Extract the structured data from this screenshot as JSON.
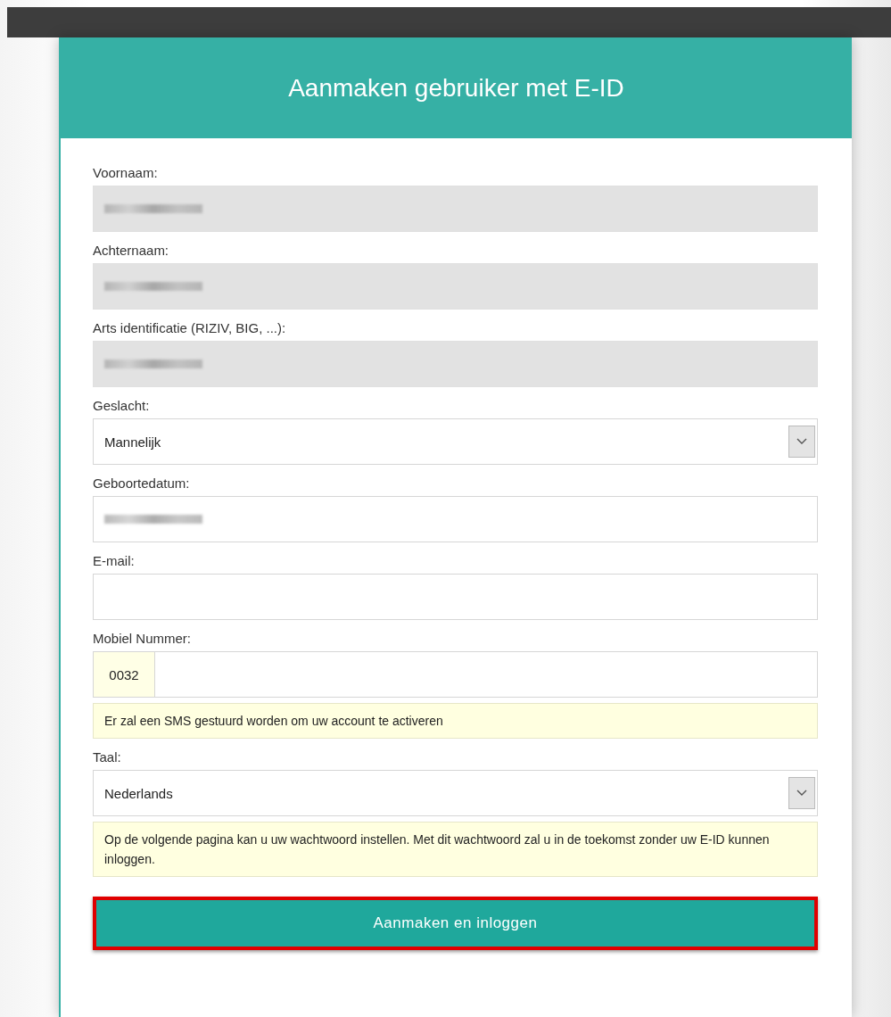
{
  "header": {
    "title": "Aanmaken gebruiker met E-ID"
  },
  "fields": [
    {
      "kind": "readonly",
      "label": "Voornaam:",
      "redacted": true
    },
    {
      "kind": "readonly",
      "label": "Achternaam:",
      "redacted": true
    },
    {
      "kind": "readonly",
      "label": "Arts identificatie (RIZIV, BIG, ...):",
      "redacted": true
    },
    {
      "kind": "select",
      "label": "Geslacht:",
      "value": "Mannelijk"
    },
    {
      "kind": "text",
      "label": "Geboortedatum:",
      "redacted": true
    },
    {
      "kind": "text",
      "label": "E-mail:",
      "redacted": false
    },
    {
      "kind": "phone",
      "label": "Mobiel Nummer:",
      "prefix": "0032",
      "notice": "Er zal een SMS gestuurd worden om uw account te activeren"
    },
    {
      "kind": "select",
      "label": "Taal:",
      "value": "Nederlands"
    }
  ],
  "notice": "Op de volgende pagina kan u uw wachtwoord instellen. Met dit wachtwoord zal u in de toekomst zonder uw E-ID kunnen inloggen.",
  "submit": {
    "label": "Aanmaken en inloggen",
    "highlighted": true
  }
}
